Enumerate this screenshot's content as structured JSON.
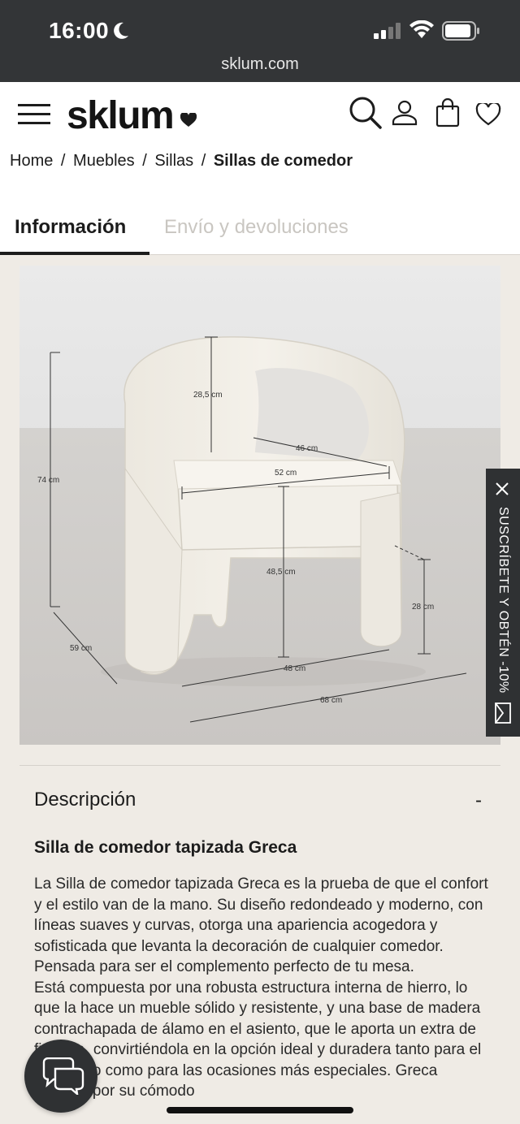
{
  "status_bar": {
    "time": "16:00",
    "url": "sklum.com"
  },
  "header": {
    "logo": "sklum",
    "icons": [
      "menu-icon",
      "search-icon",
      "user-icon",
      "cart-icon",
      "heart-icon"
    ]
  },
  "breadcrumb": {
    "items": [
      "Home",
      "Muebles",
      "Sillas"
    ],
    "current": "Sillas de comedor",
    "separator": "/"
  },
  "tabs": [
    {
      "label": "Información",
      "active": true
    },
    {
      "label": "Envío y devoluciones",
      "active": false
    }
  ],
  "image": {
    "dimensions": {
      "backrest": "28,5 cm",
      "seat_depth": "46 cm",
      "seat_width": "52 cm",
      "height": "74 cm",
      "seat_height": "48,5 cm",
      "arm_height": "28 cm",
      "depth": "59 cm",
      "inner_width": "48 cm",
      "width": "68 cm"
    }
  },
  "subscribe_banner": {
    "label": "SUSCRÍBETE Y OBTÉN -10%"
  },
  "description": {
    "section_title": "Descripción",
    "toggle": "-",
    "product_title": "Silla de comedor tapizada Greca",
    "paragraph_1": "La Silla de comedor tapizada Greca es la prueba de que el confort y el estilo van de la mano. Su diseño redondeado y moderno, con líneas suaves y curvas, otorga una apariencia acogedora y sofisticada que levanta la decoración de cualquier comedor. Pensada para ser el complemento perfecto de tu mesa.",
    "paragraph_2": "Está compuesta por una robusta estructura interna de hierro, lo que la hace un mueble sólido y resistente, y una base de madera contrachapada de álamo en el asiento, que le aporta un extra de firmeza, convirtiéndola en la opción ideal y duradera tanto para el uso diario como para las ocasiones más especiales. Greca destaca por su cómodo"
  },
  "colors": {
    "status_bar_bg": "#333537",
    "page_bg": "#efebe5",
    "text": "#1c1c1c",
    "inactive_tab": "#c9c6c1",
    "banner_bg": "#2f3133"
  }
}
